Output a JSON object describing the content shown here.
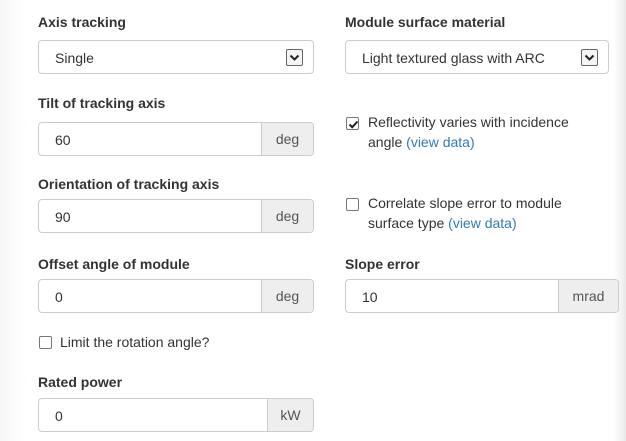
{
  "axis_tracking": {
    "label": "Axis tracking",
    "value": "Single"
  },
  "module_surface_material": {
    "label": "Module surface material",
    "value": "Light textured glass with ARC"
  },
  "tilt": {
    "label": "Tilt of tracking axis",
    "value": "60",
    "unit": "deg"
  },
  "reflectivity": {
    "checked": true,
    "text_line1": "Reflectivity varies with incidence",
    "text_line2": "angle",
    "link": "(view data)"
  },
  "orientation": {
    "label": "Orientation of tracking axis",
    "value": "90",
    "unit": "deg"
  },
  "correlate": {
    "checked": false,
    "text_line1": "Correlate slope error to module",
    "text_line2": "surface type",
    "link": "(view data)"
  },
  "offset": {
    "label": "Offset angle of module",
    "value": "0",
    "unit": "deg"
  },
  "slope_error": {
    "label": "Slope error",
    "value": "10",
    "unit": "mrad"
  },
  "limit_rotation": {
    "checked": false,
    "text": "Limit the rotation angle?"
  },
  "rated_power": {
    "label": "Rated power",
    "value": "0",
    "unit": "kW"
  }
}
